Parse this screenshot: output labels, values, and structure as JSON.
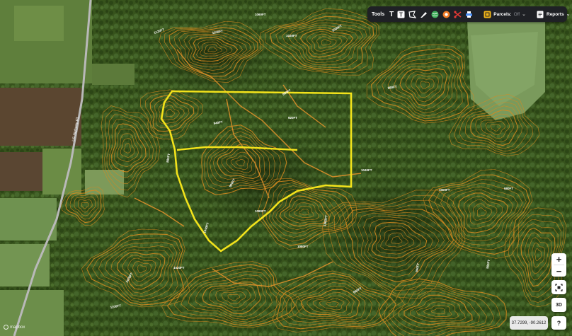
{
  "toolbar": {
    "tools_label": "Tools",
    "parcels_label": "Parcels:",
    "parcels_state": "Off",
    "reports_label": "Reports",
    "icons": [
      "text-icon",
      "text-box-icon",
      "polygon-icon",
      "pen-icon",
      "globe-icon",
      "record-icon",
      "scissors-icon",
      "print-icon",
      "parcels-icon",
      "reports-icon"
    ]
  },
  "map": {
    "highway_label": "US Highway 63",
    "contour_labels": [
      {
        "text": "1120FT"
      },
      {
        "text": "1100FT"
      },
      {
        "text": "1060FT"
      },
      {
        "text": "1020FT"
      },
      {
        "text": "1000FT"
      },
      {
        "text": "980FT"
      },
      {
        "text": "960FT"
      },
      {
        "text": "940FT"
      },
      {
        "text": "920FT"
      },
      {
        "text": "900FT"
      },
      {
        "text": "880FT"
      },
      {
        "text": "1040FT"
      },
      {
        "text": "1080FT"
      },
      {
        "text": "1060FT"
      },
      {
        "text": "1040FT"
      },
      {
        "text": "1000FT"
      },
      {
        "text": "980FT"
      },
      {
        "text": "960FT"
      },
      {
        "text": "1020FT"
      },
      {
        "text": "1100FT"
      },
      {
        "text": "940FT"
      },
      {
        "text": "900FT"
      },
      {
        "text": "1020FT"
      },
      {
        "text": "1080FT"
      }
    ],
    "colors": {
      "contour": "#d98a1f",
      "boundary": "#f2e21b",
      "forest": "#3d5a1f",
      "field": "#6f8f4a"
    }
  },
  "controls": {
    "zoom_in": "+",
    "zoom_out": "−",
    "locate_icon": "locate-icon",
    "three_d": "3D",
    "help": "?",
    "coordinates": "37.7299, -90.2612"
  },
  "attribution": "mapbox"
}
